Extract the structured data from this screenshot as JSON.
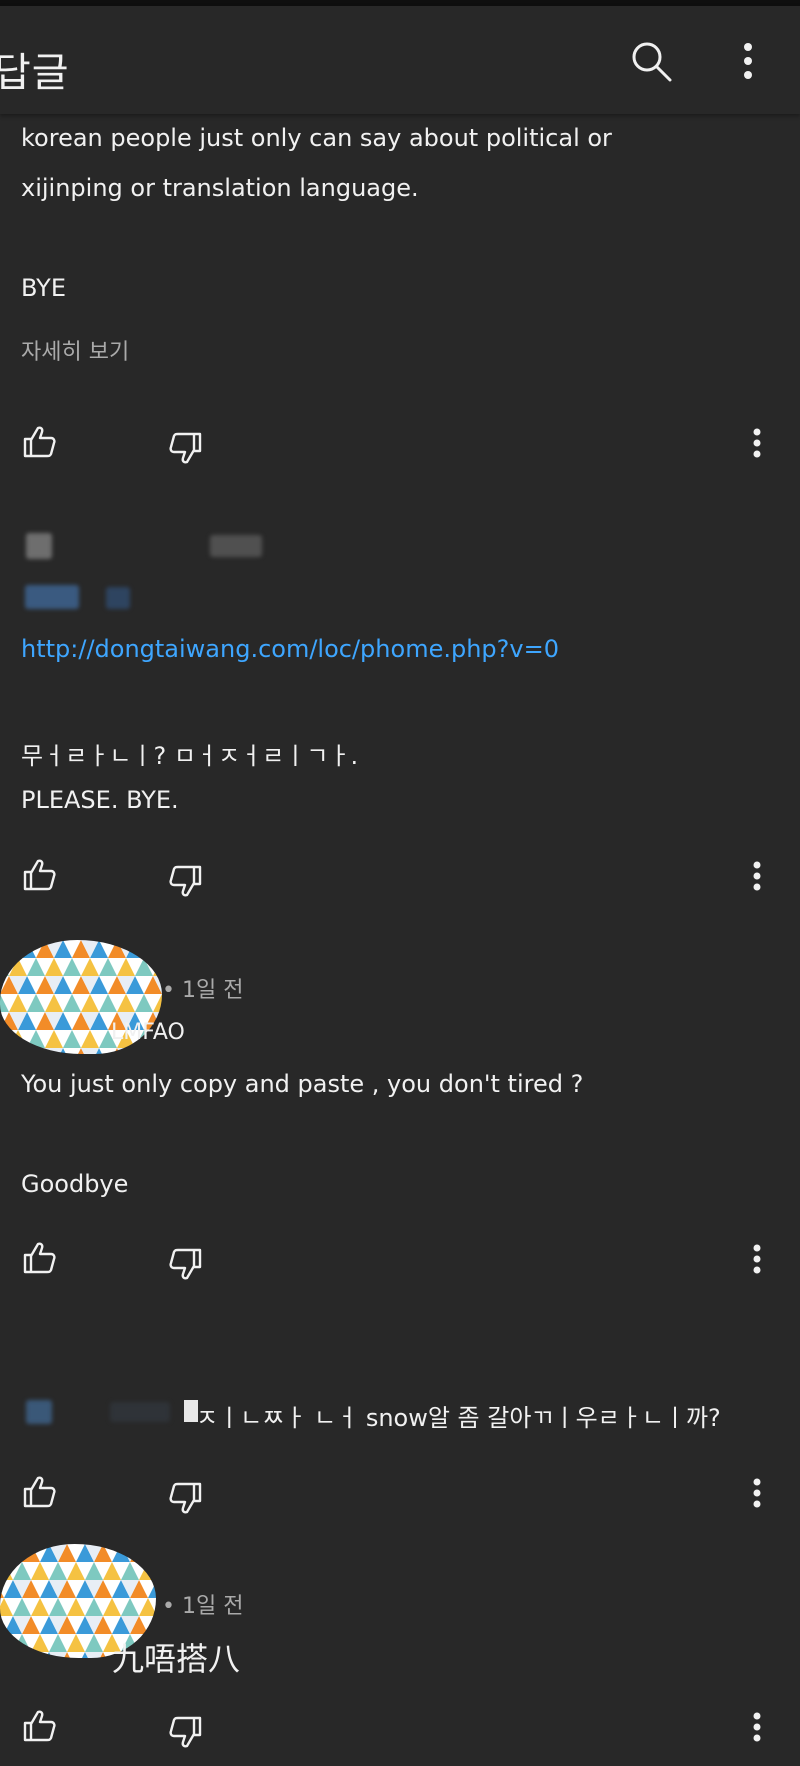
{
  "header": {
    "title": "답글",
    "search_icon": "search-icon",
    "more_icon": "more-vert-icon"
  },
  "comment1": {
    "line1": "korean people just only can say about political or",
    "line2": "xijinping or translation language.",
    "line3": "BYE",
    "read_more": "자세히 보기"
  },
  "comment2": {
    "link": "http://dongtaiwang.com/loc/phome.php?v=0",
    "line1": "무ㅓㄹㅏㄴㅣ? ㅁㅓㅈㅓㄹㅣㄱㅏ.",
    "line2": "PLEASE. BYE."
  },
  "comment3": {
    "time": "• 1일 전",
    "author": "LMFAO",
    "line1": "You just only copy and paste , you don't tired ?",
    "line2": "Goodbye"
  },
  "comment4": {
    "line1": "ㅈㅣㄴㅉㅏ ㄴㅓ snow알 좀 갈아ㄲㅣ우ㄹㅏㄴㅣ까?"
  },
  "comment5": {
    "time": "• 1일 전",
    "line1": "九唔搭八"
  },
  "colors": {
    "background": "#282828",
    "text": "#f1f1f1",
    "muted": "#aaaaaa",
    "link": "#3ea6ff"
  }
}
